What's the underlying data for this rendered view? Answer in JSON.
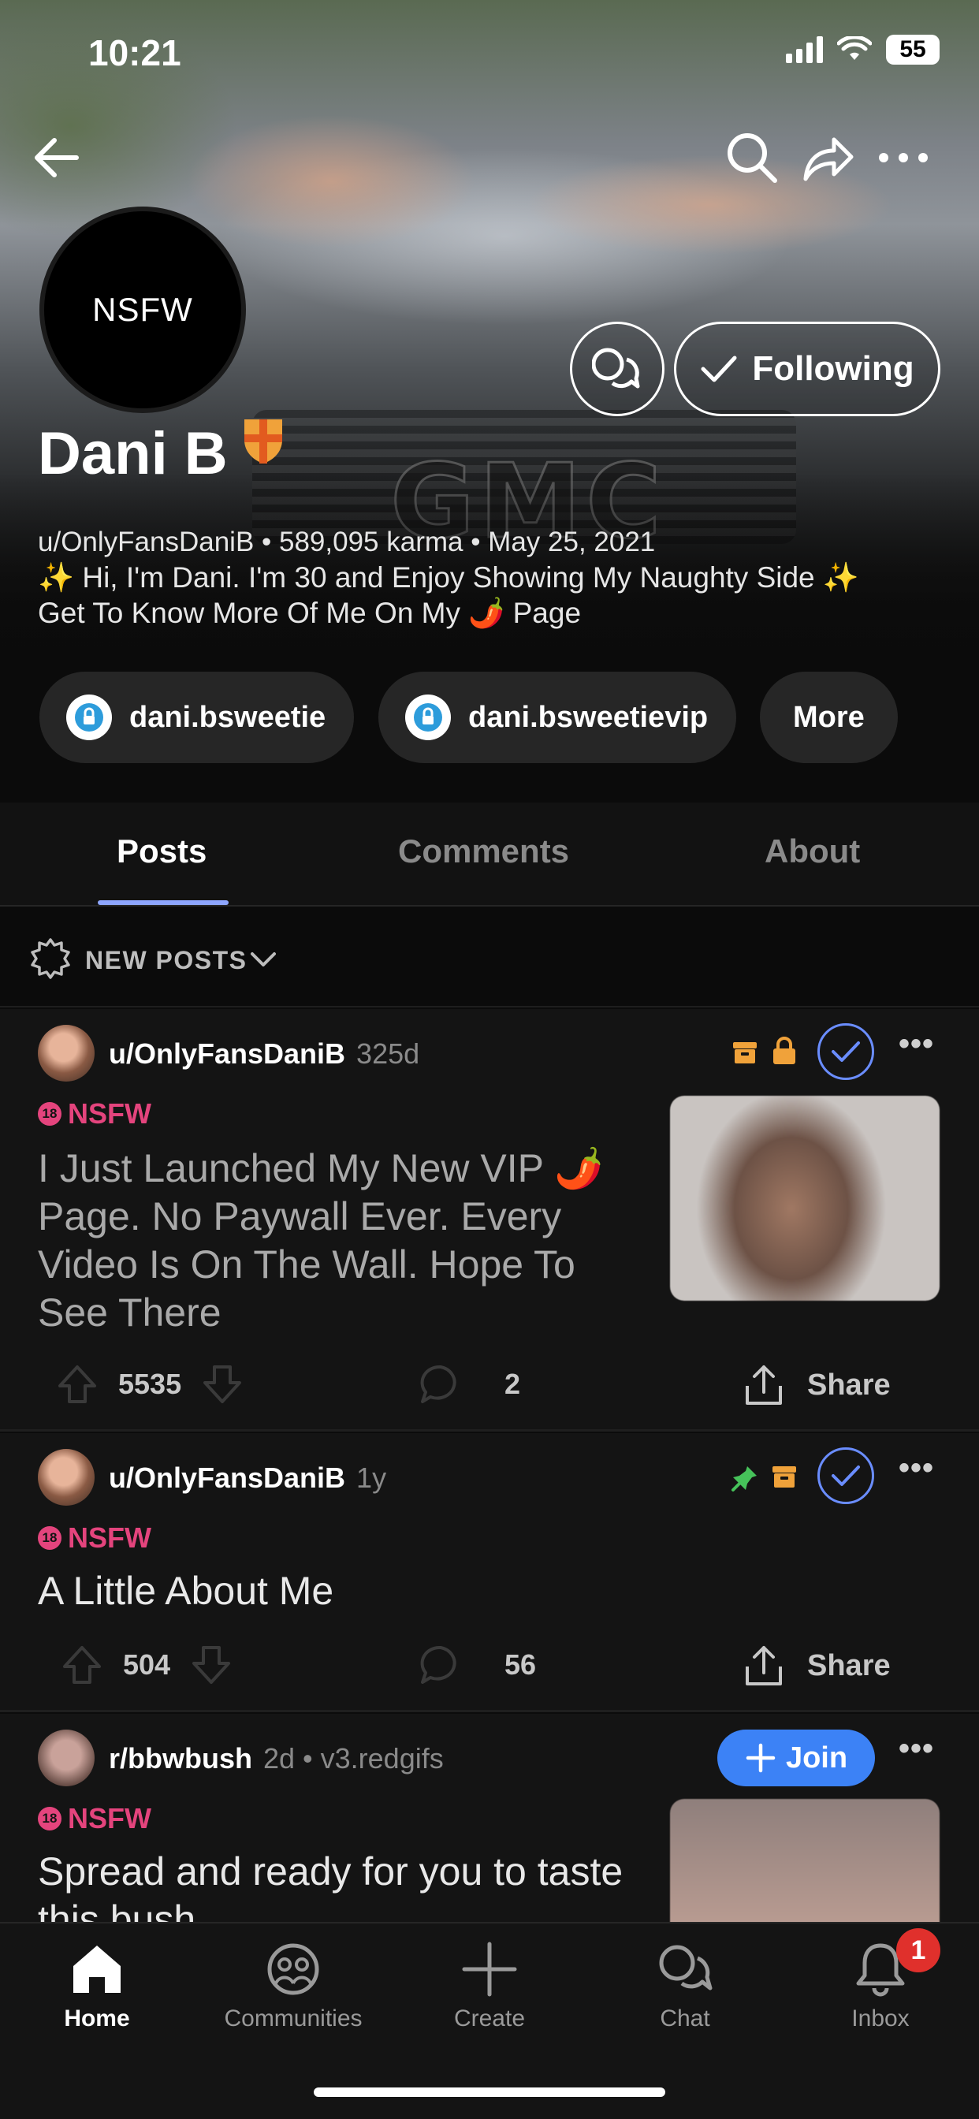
{
  "status_bar": {
    "time": "10:21",
    "battery": "55"
  },
  "profile": {
    "avatar_text": "NSFW",
    "display_name": "Dani B",
    "meta": "u/OnlyFansDaniB • 589,095 karma • May 25, 2021",
    "bio_line1": "✨ Hi, I'm Dani. I'm 30 and Enjoy Showing My Naughty Side ✨",
    "bio_line2": "Get To Know More Of Me On My 🌶️ Page",
    "following_label": "Following",
    "links": [
      {
        "label": "dani.bsweetie"
      },
      {
        "label": "dani.bsweetievip"
      }
    ],
    "more_label": "More"
  },
  "tabs": [
    {
      "label": "Posts",
      "active": true
    },
    {
      "label": "Comments",
      "active": false
    },
    {
      "label": "About",
      "active": false
    }
  ],
  "sort": {
    "label": "NEW POSTS"
  },
  "posts": [
    {
      "user": "u/OnlyFansDaniB",
      "age": "325d",
      "nsfw_label": "NSFW",
      "title": "I Just Launched My New VIP 🌶️ Page. No Paywall Ever. Every Video Is On The Wall. Hope To See There",
      "score": "5535",
      "comments": "2",
      "share_label": "Share"
    },
    {
      "user": "u/OnlyFansDaniB",
      "age": "1y",
      "nsfw_label": "NSFW",
      "title": "A Little About Me",
      "score": "504",
      "comments": "56",
      "share_label": "Share"
    },
    {
      "user": "r/bbwbush",
      "age": "2d • v3.redgifs",
      "nsfw_label": "NSFW",
      "title": "Spread and ready for you to taste this bush",
      "join_label": "Join"
    }
  ],
  "bottom_nav": [
    {
      "label": "Home",
      "icon": "home-icon",
      "active": true
    },
    {
      "label": "Communities",
      "icon": "communities-icon",
      "active": false
    },
    {
      "label": "Create",
      "icon": "plus-icon",
      "active": false
    },
    {
      "label": "Chat",
      "icon": "chat-icon",
      "active": false
    },
    {
      "label": "Inbox",
      "icon": "bell-icon",
      "active": false
    }
  ],
  "inbox_badge": "1",
  "colors": {
    "accent_blue": "#3c82f6",
    "nsfw_pink": "#e4447d",
    "tab_indicator": "#8ea6ff",
    "badge_red": "#e0302c",
    "mod_orange": "#f0a23a"
  }
}
